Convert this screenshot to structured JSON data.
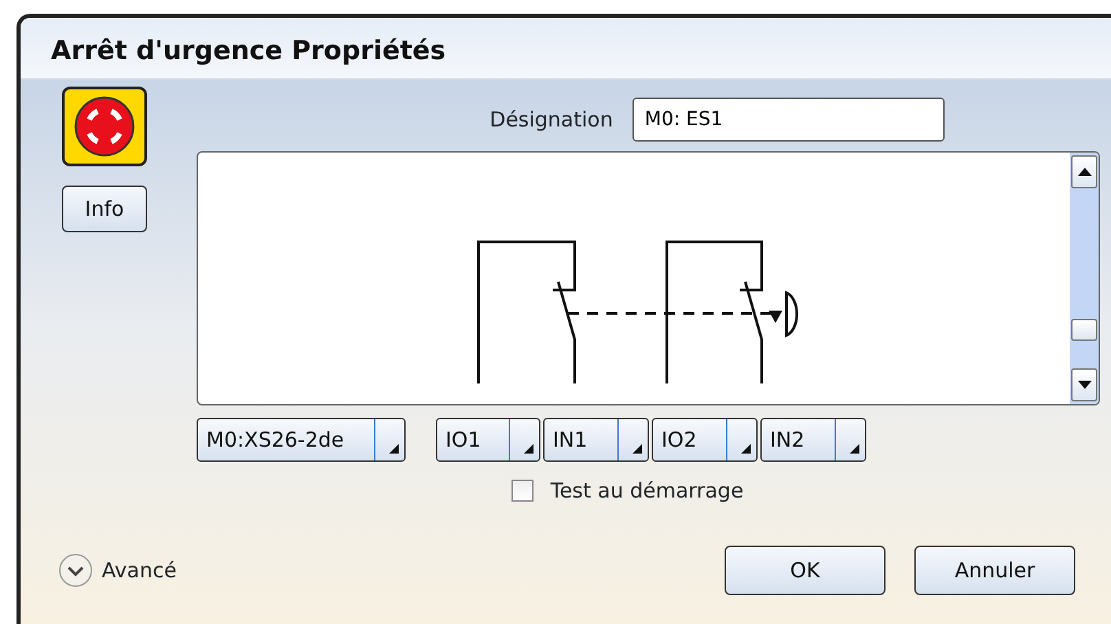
{
  "window": {
    "title": "Arrêt d'urgence Propriétés"
  },
  "info_button": "Info",
  "designation": {
    "label": "Désignation",
    "value": "M0: ES1"
  },
  "device_selector": {
    "value": "M0:XS26-2de"
  },
  "io_selectors": [
    {
      "value": "IO1"
    },
    {
      "value": "IN1"
    },
    {
      "value": "IO2"
    },
    {
      "value": "IN2"
    }
  ],
  "test_checkbox": {
    "label": "Test au démarrage",
    "checked": false
  },
  "advanced": {
    "label": "Avancé",
    "expanded": false
  },
  "buttons": [
    "OK",
    "Annuler"
  ]
}
